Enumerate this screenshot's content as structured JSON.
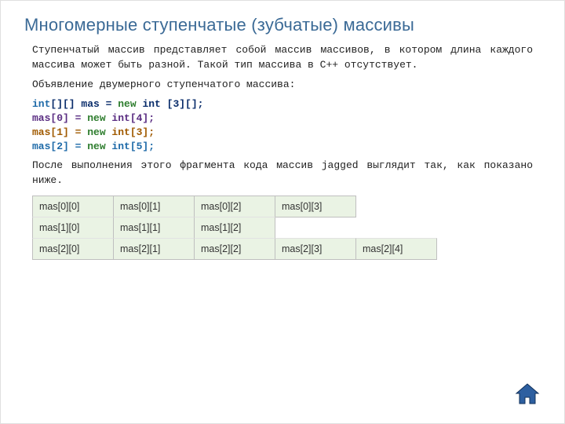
{
  "heading": "Многомерные ступенчатые (зубчатые) массивы",
  "para1": "Ступенчатый массив представляет собой массив массивов, в котором длина каждого массива может быть разной. Такой тип массива в C++ отсутствует.",
  "para2": "Объявление двумерного ступенчатого массива:",
  "code": {
    "l1_a": "int",
    "l1_b": "[][] mas = ",
    "l1_c": "new",
    "l1_d": " int ",
    "l1_e": "[3][];",
    "l2_a": "mas[0] = ",
    "l2_b": "new",
    "l2_c": " int[4];",
    "l3_a": "mas[1] = ",
    "l3_b": "new",
    "l3_c": " int[3];",
    "l4_a": "mas[2] = ",
    "l4_b": "new",
    "l4_c": " int[5];"
  },
  "para3": "После выполнения этого фрагмента кода массив jagged выглядит так, как показано ниже.",
  "table": {
    "r0": [
      "mas[0][0]",
      "mas[0][1]",
      "mas[0][2]",
      "mas[0][3]"
    ],
    "r1": [
      "mas[1][0]",
      "mas[1][1]",
      "mas[1][2]"
    ],
    "r2": [
      "mas[2][0]",
      "mas[2][1]",
      "mas[2][2]",
      "mas[2][3]",
      "mas[2][4]"
    ]
  }
}
